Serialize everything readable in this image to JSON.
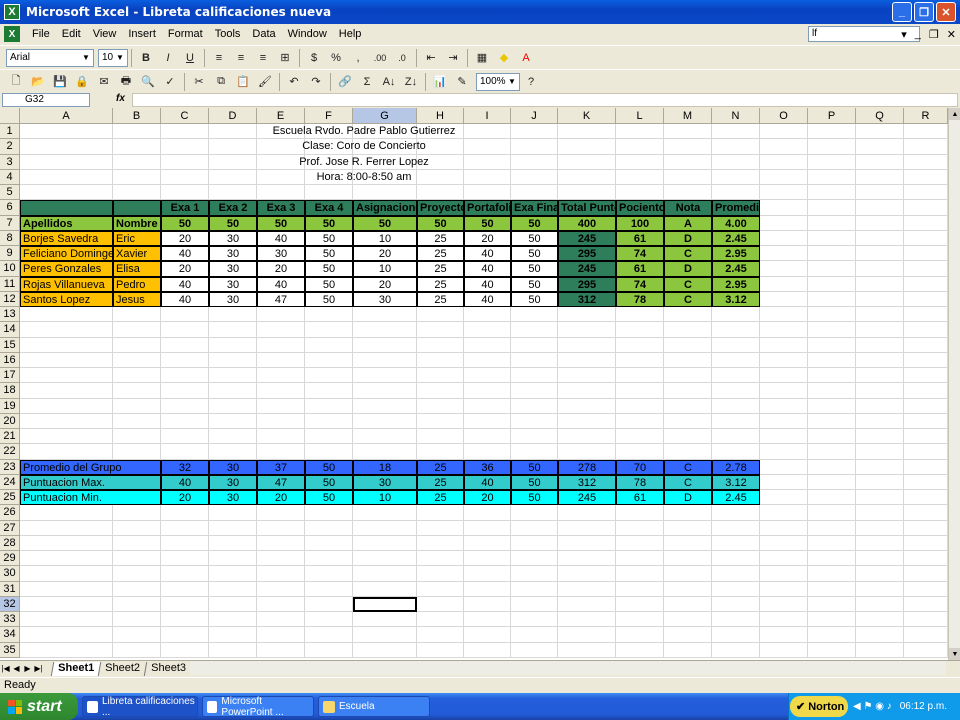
{
  "window": {
    "title": "Microsoft Excel - Libreta calificaciones nueva"
  },
  "menu": [
    "File",
    "Edit",
    "View",
    "Insert",
    "Format",
    "Tools",
    "Data",
    "Window",
    "Help"
  ],
  "help_box": "lf",
  "toolbar": {
    "font": "Arial",
    "size": "10",
    "zoom": "100%"
  },
  "namebox": "G32",
  "fx_label": "fx",
  "columns": [
    "A",
    "B",
    "C",
    "D",
    "E",
    "F",
    "G",
    "H",
    "I",
    "J",
    "K",
    "L",
    "M",
    "N",
    "O",
    "P",
    "Q",
    "R"
  ],
  "header_lines": [
    "Escuela Rvdo. Padre Pablo Gutierrez",
    "Clase: Coro de Concierto",
    "Prof. Jose R. Ferrer Lopez",
    "Hora: 8:00-8:50 am"
  ],
  "table": {
    "headers": [
      "",
      "",
      "Exa 1",
      "Exa 2",
      "Exa 3",
      "Exa 4",
      "Asignaciones",
      "Proyecto",
      "Portafolio",
      "Exa Final",
      "Total Puntos",
      "Pociento",
      "Nota",
      "Promedio"
    ],
    "max_row": [
      "Apellidos",
      "Nombre",
      "50",
      "50",
      "50",
      "50",
      "50",
      "50",
      "50",
      "50",
      "400",
      "100",
      "A",
      "4.00"
    ],
    "students": [
      [
        "Borjes Savedra",
        "Eric",
        "20",
        "30",
        "40",
        "50",
        "10",
        "25",
        "20",
        "50",
        "245",
        "61",
        "D",
        "2.45"
      ],
      [
        "Feliciano Domingez",
        "Xavier",
        "40",
        "30",
        "30",
        "50",
        "20",
        "25",
        "40",
        "50",
        "295",
        "74",
        "C",
        "2.95"
      ],
      [
        "Peres Gonzales",
        "Elisa",
        "20",
        "30",
        "20",
        "50",
        "10",
        "25",
        "40",
        "50",
        "245",
        "61",
        "D",
        "2.45"
      ],
      [
        "Rojas Villanueva",
        "Pedro",
        "40",
        "30",
        "40",
        "50",
        "20",
        "25",
        "40",
        "50",
        "295",
        "74",
        "C",
        "2.95"
      ],
      [
        "Santos Lopez",
        "Jesus",
        "40",
        "30",
        "47",
        "50",
        "30",
        "25",
        "40",
        "50",
        "312",
        "78",
        "C",
        "3.12"
      ]
    ],
    "summary": [
      [
        "Promedio del  Grupo",
        "",
        "32",
        "30",
        "37",
        "50",
        "18",
        "25",
        "36",
        "50",
        "278",
        "70",
        "C",
        "2.78"
      ],
      [
        "Puntuacion Max.",
        "",
        "40",
        "30",
        "47",
        "50",
        "30",
        "25",
        "40",
        "50",
        "312",
        "78",
        "C",
        "3.12"
      ],
      [
        "Puntuacion Min.",
        "",
        "20",
        "30",
        "20",
        "50",
        "10",
        "25",
        "20",
        "50",
        "245",
        "61",
        "D",
        "2.45"
      ]
    ]
  },
  "sheets": [
    "Sheet1",
    "Sheet2",
    "Sheet3"
  ],
  "status": "Ready",
  "taskbar": {
    "start": "start",
    "tasks": [
      "Libreta calificaciones ...",
      "Microsoft PowerPoint ...",
      "Escuela"
    ],
    "norton": "Norton",
    "clock": "06:12 p.m."
  },
  "colors": {
    "dark_green": "#2e7d5b",
    "lime": "#8cc63f",
    "orange": "#ffc000",
    "blue": "#3366ff",
    "teal": "#33cccc",
    "cyan": "#00ffff"
  }
}
